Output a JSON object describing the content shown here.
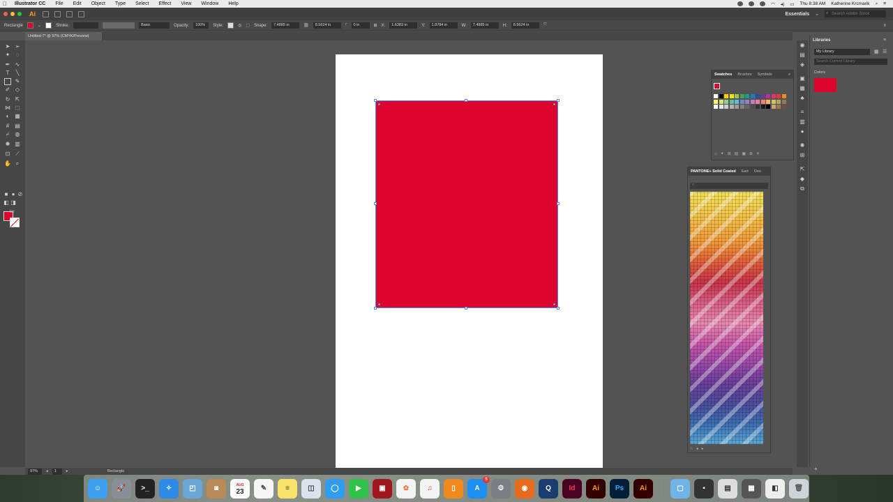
{
  "menubar": {
    "app_name": "Illustrator CC",
    "items": [
      "File",
      "Edit",
      "Object",
      "Type",
      "Select",
      "Effect",
      "View",
      "Window",
      "Help"
    ],
    "clock": "Thu 8:38 AM",
    "user": "Katherine Krcmarik"
  },
  "appbar": {
    "logo": "Ai",
    "workspace": "Essentials",
    "search_placeholder": "Search Adobe Stock"
  },
  "controlbar": {
    "object_type": "Rectangle",
    "stroke_label": "Stroke:",
    "brush_label": "Basic",
    "opacity_label": "Opacity:",
    "opacity_value": "100%",
    "style_label": "Style:",
    "shape_label": "Shape:",
    "shape_w": "7.4885 in",
    "shape_h": "8.5624 in",
    "corner_value": "0 in",
    "x_label": "X:",
    "x_value": "1.6383 in",
    "y_label": "Y:",
    "y_value": "1.8784 in",
    "w_label": "W:",
    "w_value": "7.4885 in",
    "h_label": "H:",
    "h_value": "8.5624 in",
    "fill_color": "#dc052b"
  },
  "document": {
    "tab_title": "Untitled-7* @ 97% (CMYK/Preview)",
    "zoom": "97%",
    "page": "1",
    "status_tool": "Rectangle"
  },
  "libraries": {
    "title": "Libraries",
    "library_name": "My Library",
    "search_placeholder": "Search Current Library",
    "section": "Colors",
    "color": "#dc052b"
  },
  "swatches_panel": {
    "tabs": [
      "Swatches",
      "Brushes",
      "Symbols"
    ]
  },
  "pantone_panel": {
    "tabs": [
      "PANTONE+ Solid Coated",
      "Eart",
      "Deo"
    ]
  },
  "dock": {
    "calendar_day": "23",
    "calendar_month": "AUG",
    "apps": [
      "Finder",
      "Launchpad",
      "Terminal",
      "Safari",
      "Preview",
      "Contacts",
      "Calendar",
      "TextEdit",
      "Notes",
      "Preview2",
      "Messages",
      "FaceTime",
      "Photo Booth",
      "Photos",
      "iTunes",
      "iBooks",
      "App Store",
      "System Preferences",
      "Firefox",
      "QuickTime",
      "InDesign",
      "Illustrator",
      "Photoshop",
      "Illustrator CC"
    ],
    "badge": "5"
  }
}
